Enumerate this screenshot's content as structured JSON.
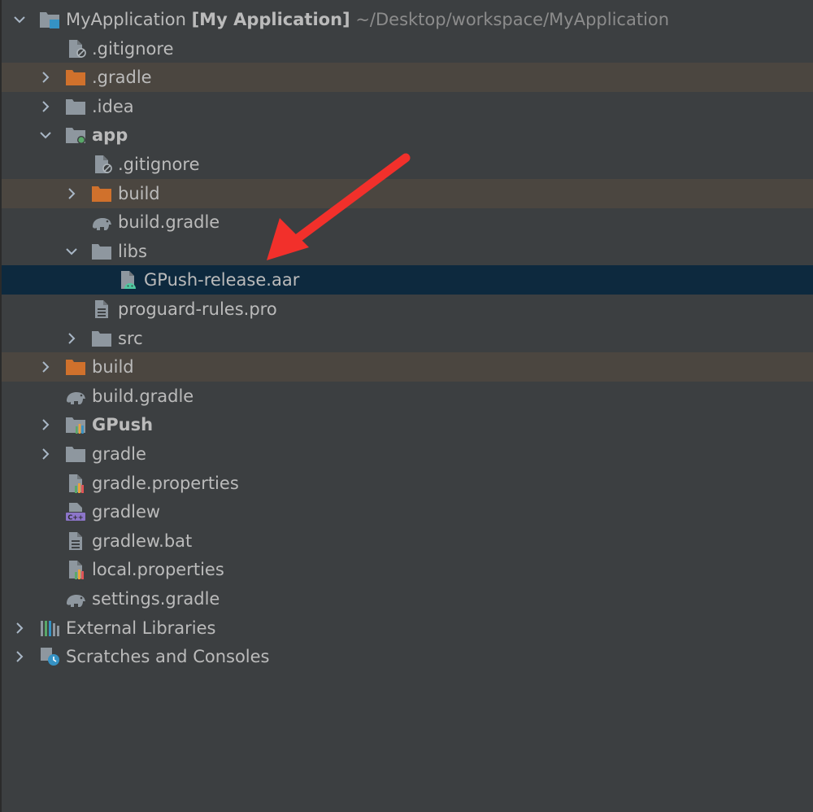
{
  "project": {
    "name": "MyApplication",
    "module": "[My Application]",
    "path": "~/Desktop/workspace/MyApplication"
  },
  "rows": [
    {
      "label": ".gitignore",
      "level": 1,
      "icon": "ignore-file-icon",
      "chevron": "none"
    },
    {
      "label": ".gradle",
      "level": 1,
      "icon": "excluded-folder-icon",
      "chevron": "right",
      "state": "excluded"
    },
    {
      "label": ".idea",
      "level": 1,
      "icon": "folder-icon",
      "chevron": "right"
    },
    {
      "label": "app",
      "level": 1,
      "icon": "module-folder-icon",
      "chevron": "down",
      "bold": true
    },
    {
      "label": ".gitignore",
      "level": 2,
      "icon": "ignore-file-icon",
      "chevron": "none"
    },
    {
      "label": "build",
      "level": 2,
      "icon": "excluded-folder-icon",
      "chevron": "right",
      "state": "excluded"
    },
    {
      "label": "build.gradle",
      "level": 2,
      "icon": "gradle-elephant-icon",
      "chevron": "none"
    },
    {
      "label": "libs",
      "level": 2,
      "icon": "folder-icon",
      "chevron": "down"
    },
    {
      "label": "GPush-release.aar",
      "level": 3,
      "icon": "android-archive-icon",
      "chevron": "none",
      "state": "selected"
    },
    {
      "label": "proguard-rules.pro",
      "level": 2,
      "icon": "text-file-icon",
      "chevron": "none"
    },
    {
      "label": "src",
      "level": 2,
      "icon": "folder-icon",
      "chevron": "right"
    },
    {
      "label": "build",
      "level": 1,
      "icon": "excluded-folder-icon",
      "chevron": "right",
      "state": "excluded"
    },
    {
      "label": "build.gradle",
      "level": 1,
      "icon": "gradle-elephant-icon",
      "chevron": "none"
    },
    {
      "label": "GPush",
      "level": 1,
      "icon": "module-bars-folder-icon",
      "chevron": "right",
      "bold": true
    },
    {
      "label": "gradle",
      "level": 1,
      "icon": "folder-icon",
      "chevron": "right"
    },
    {
      "label": "gradle.properties",
      "level": 1,
      "icon": "properties-file-icon",
      "chevron": "none"
    },
    {
      "label": "gradlew",
      "level": 1,
      "icon": "shell-script-icon",
      "chevron": "none"
    },
    {
      "label": "gradlew.bat",
      "level": 1,
      "icon": "text-file-icon",
      "chevron": "none"
    },
    {
      "label": "local.properties",
      "level": 1,
      "icon": "properties-file-icon",
      "chevron": "none"
    },
    {
      "label": "settings.gradle",
      "level": 1,
      "icon": "gradle-elephant-icon",
      "chevron": "none"
    },
    {
      "label": "External Libraries",
      "level": 0,
      "icon": "libraries-icon",
      "chevron": "right"
    },
    {
      "label": "Scratches and Consoles",
      "level": 0,
      "icon": "scratches-icon",
      "chevron": "right"
    }
  ],
  "colors": {
    "background": "#3c3f41",
    "excluded_row": "#4b4640",
    "selected_row": "#0d293e",
    "text": "#bbbbbb",
    "path_text": "#8c8c8c",
    "folder": "#8e979f",
    "excluded_folder": "#d0712c",
    "arrow": "#f2302b"
  }
}
